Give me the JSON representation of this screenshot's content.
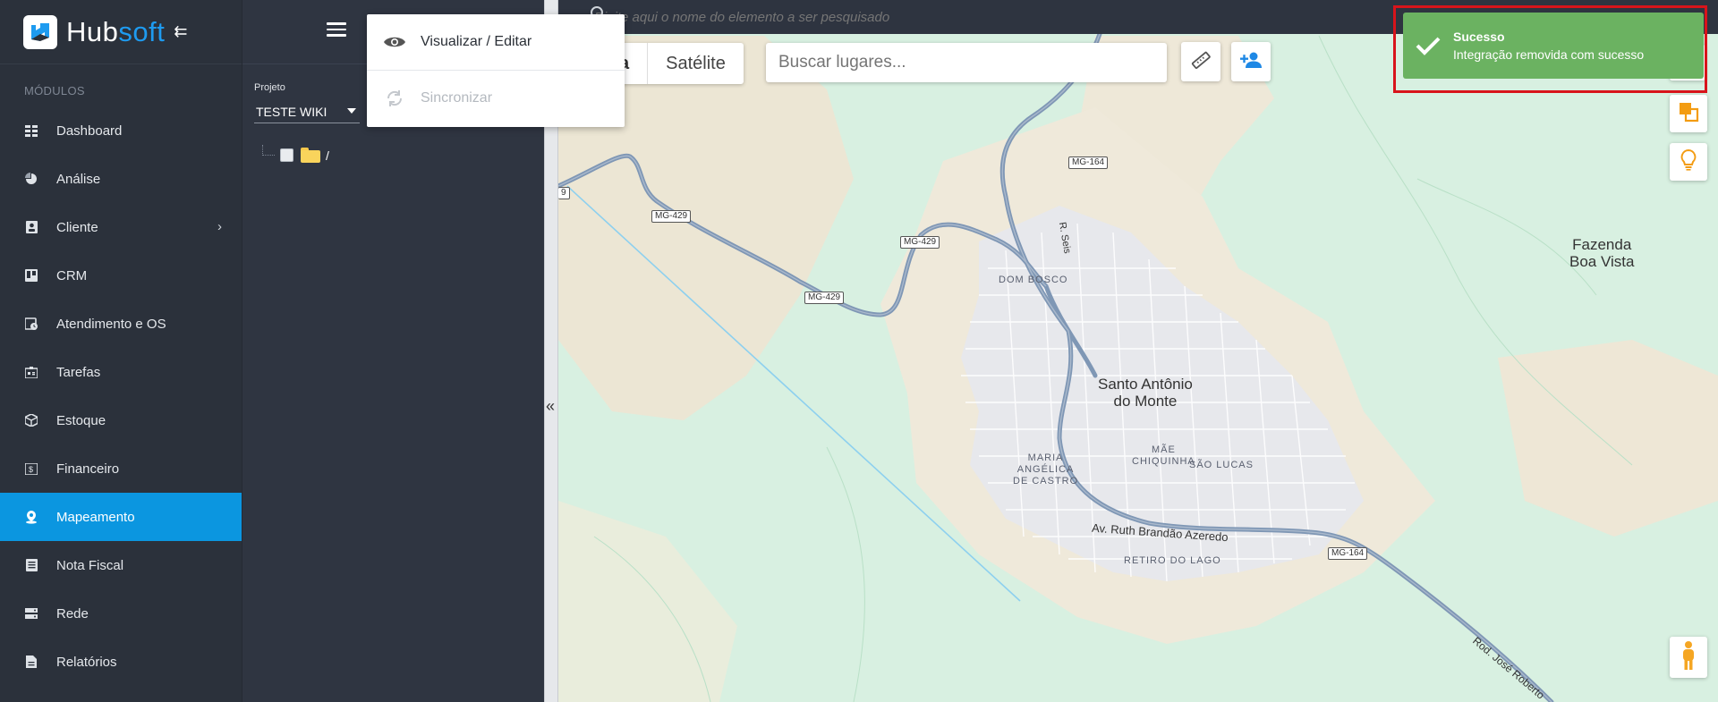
{
  "brand": {
    "name_a": "Hub",
    "name_b": "soft",
    "accent": "#1e9bf0"
  },
  "nav": {
    "section_title": "MÓDULOS",
    "items": [
      {
        "label": "Dashboard",
        "icon": "grid-icon"
      },
      {
        "label": "Análise",
        "icon": "pie-chart-icon"
      },
      {
        "label": "Cliente",
        "icon": "contact-card-icon",
        "has_submenu": true
      },
      {
        "label": "CRM",
        "icon": "kanban-icon"
      },
      {
        "label": "Atendimento e OS",
        "icon": "clock-calendar-icon"
      },
      {
        "label": "Tarefas",
        "icon": "task-board-icon"
      },
      {
        "label": "Estoque",
        "icon": "box-icon"
      },
      {
        "label": "Financeiro",
        "icon": "money-icon"
      },
      {
        "label": "Mapeamento",
        "icon": "map-pin-icon",
        "active": true
      },
      {
        "label": "Nota Fiscal",
        "icon": "document-icon"
      },
      {
        "label": "Rede",
        "icon": "server-icon"
      },
      {
        "label": "Relatórios",
        "icon": "report-icon"
      }
    ]
  },
  "panel": {
    "project_label": "Projeto",
    "project_value": "TESTE WIKI",
    "tree_root": "/"
  },
  "menu": {
    "items": [
      {
        "label": "Visualizar / Editar",
        "icon": "eye-icon",
        "disabled": false
      },
      {
        "label": "Sincronizar",
        "icon": "sync-icon",
        "disabled": true
      }
    ]
  },
  "map": {
    "search_placeholder": "Digite aqui o nome do elemento a ser pesquisado",
    "maptype": {
      "first": "a",
      "second": "Satélite"
    },
    "places_placeholder": "Buscar lugares...",
    "labels": {
      "city_line1": "Santo Antônio",
      "city_line2": "do Monte",
      "fazenda_line1": "Fazenda",
      "fazenda_line2": "Boa Vista",
      "dom_bosco": "DOM BOSCO",
      "maria_line1": "MARIA",
      "maria_line2": "ANGÉLICA",
      "maria_line3": "DE CASTRO",
      "mae_line1": "MÃE",
      "mae_line2": "CHIQUINHA",
      "sao_lucas": "SÃO LUCAS",
      "retiro": "RETIRO DO LAGO",
      "av_ruth": "Av. Ruth Brandão Azeredo",
      "rod_jose": "Rod. José Roberto",
      "r_seis": "R. Seis",
      "shield_mg429": "MG-429",
      "shield_mg164": "MG-164",
      "shield_cut": "9"
    }
  },
  "toast": {
    "title": "Sucesso",
    "message": "Integração removida com sucesso",
    "color": "#6bb261",
    "frame_color": "#d8141b"
  }
}
